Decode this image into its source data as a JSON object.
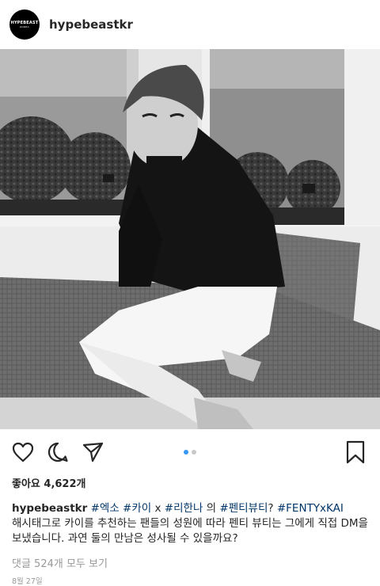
{
  "post": {
    "username": "hypebeastkr",
    "avatar_line1": "HYPEBEAST",
    "avatar_line2": "KOREA",
    "likes_label": "좋아요 4,622개",
    "caption_user": "hypebeastkr",
    "caption_tag1": "#엑소",
    "caption_tag2": "#카이",
    "caption_text1": "x",
    "caption_tag3": "#리한나",
    "caption_text2": "의",
    "caption_tag4": "#펜티뷰티",
    "caption_text3": "?",
    "caption_tag5": "#FENTYxKAI",
    "caption_body": "해시태그로 카이를 추천하는 팬들의 성원에 따라 펜티 뷰티는 그에게 직접 DM을 보냈습니다. 과연 둘의 만남은 성사될 수 있을까요?",
    "comments_link": "댓글 524개 모두 보기",
    "date": "8월 27일"
  },
  "carousel": {
    "total": 2,
    "active": 1
  },
  "icons": {
    "like": "heart-icon",
    "comment": "comment-bubble-icon",
    "share": "paper-plane-icon",
    "save": "bookmark-icon"
  },
  "colors": {
    "hashtag": "#003569",
    "dot_active": "#3897f0",
    "dot_inactive": "#c8c8c8",
    "muted": "#999999"
  }
}
